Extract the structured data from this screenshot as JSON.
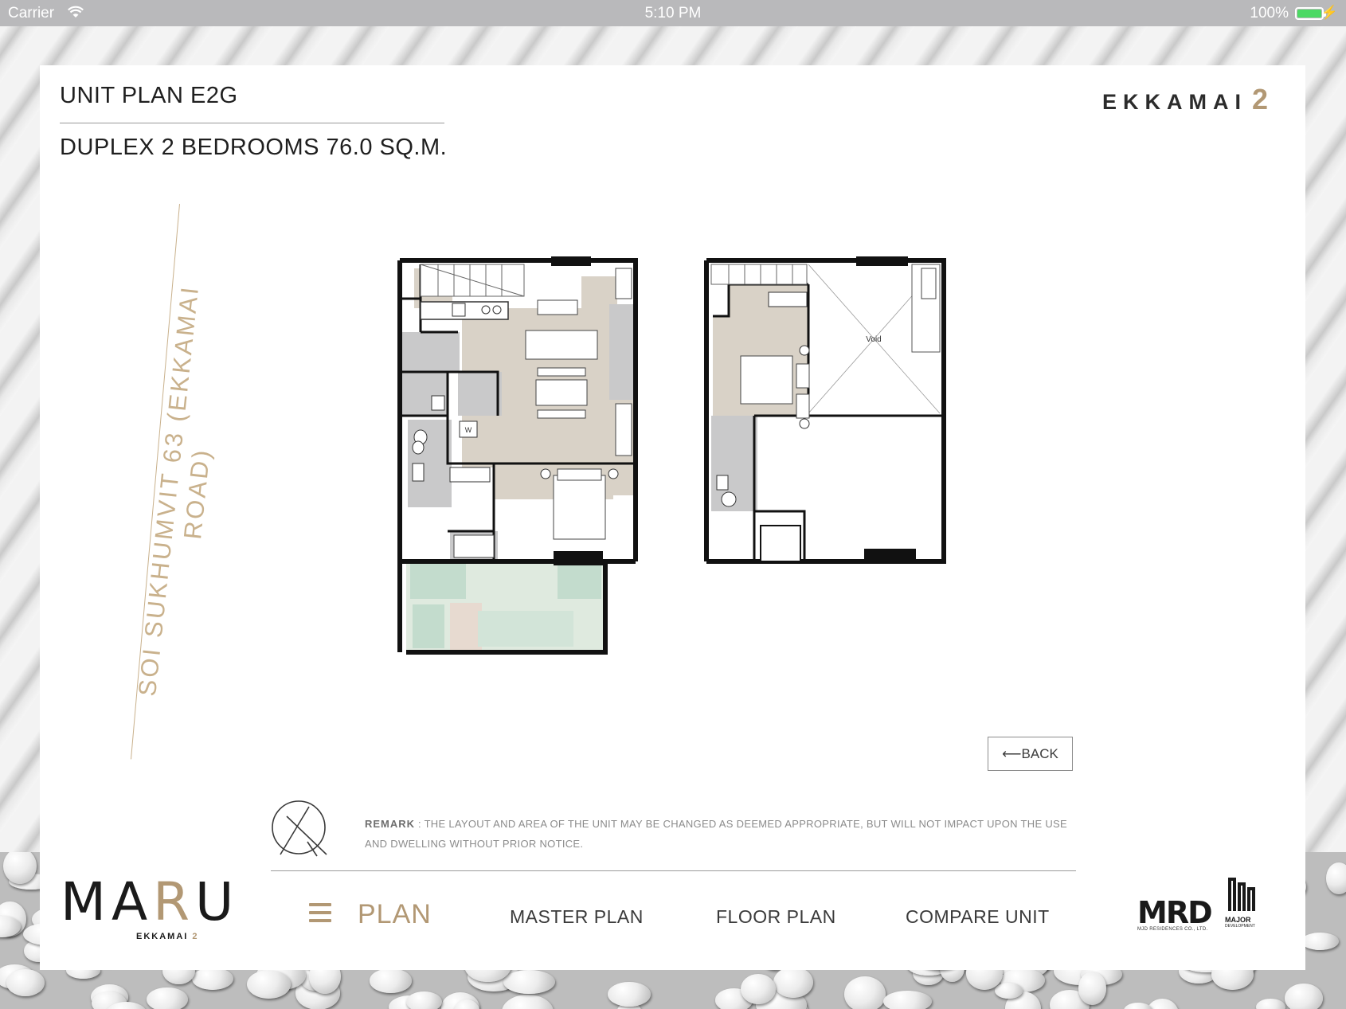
{
  "status_bar": {
    "carrier": "Carrier",
    "time": "5:10 PM",
    "battery": "100%"
  },
  "header": {
    "title": "UNIT PLAN E2G",
    "subtitle": "DUPLEX 2 BEDROOMS 76.0 SQ.M.",
    "project_logo": {
      "word": "EKKAMAI",
      "number": "2"
    }
  },
  "plan": {
    "road_label": "SOI SUKHUMVIT 63 (EKKAMAI ROAD)",
    "void_label": "Void",
    "washer_label": "W"
  },
  "back_button": {
    "label": "BACK",
    "icon": "arrow-left-icon"
  },
  "remark": {
    "label": "REMARK",
    "text": " : THE LAYOUT AND AREA OF THE UNIT MAY BE CHANGED AS DEEMED APPROPRIATE, BUT WILL NOT IMPACT UPON THE USE AND DWELLING WITHOUT PRIOR NOTICE."
  },
  "brand": {
    "name_left": "MA",
    "name_r": "R",
    "name_right": "U",
    "sub": "EKKAMAI",
    "sub_num": "2"
  },
  "nav": {
    "menu_icon": "hamburger-icon",
    "active": "PLAN",
    "items": [
      "MASTER PLAN",
      "FLOOR PLAN",
      "COMPARE UNIT"
    ]
  },
  "partners": {
    "mrd": "MRD",
    "mrd_sub": "MJD RESIDENCES CO., LTD.",
    "major_sub1": "MAJOR",
    "major_sub2": "DEVELOPMENT"
  },
  "colors": {
    "gold": "#b29874",
    "floor_beige": "#d9d2c7",
    "bath_grey": "#c9c9ca",
    "garden_green": "#cfe2d6"
  }
}
